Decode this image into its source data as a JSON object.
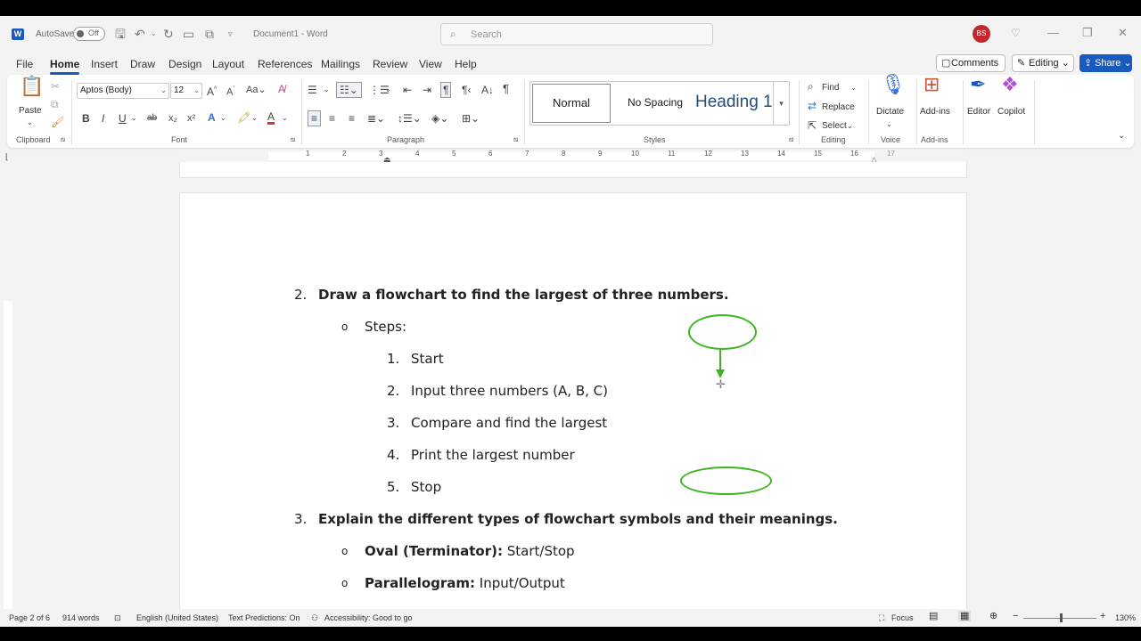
{
  "titlebar": {
    "autosave_label": "AutoSave",
    "autosave_state": "Off",
    "document_title": "Document1  -  Word",
    "search_placeholder": "Search",
    "user_initials": "BS"
  },
  "tabs": [
    "File",
    "Home",
    "Insert",
    "Draw",
    "Design",
    "Layout",
    "References",
    "Mailings",
    "Review",
    "View",
    "Help"
  ],
  "active_tab": "Home",
  "actions": {
    "comments": "Comments",
    "editing": "Editing",
    "share": "Share"
  },
  "ribbon": {
    "clipboard": {
      "paste": "Paste",
      "group": "Clipboard"
    },
    "font": {
      "name": "Aptos (Body)",
      "size": "12",
      "group": "Font",
      "bold": "B",
      "italic": "I",
      "underline": "U",
      "strike": "ab",
      "sub": "x₂",
      "sup": "x²"
    },
    "paragraph": {
      "group": "Paragraph"
    },
    "styles": {
      "normal": "Normal",
      "no_spacing": "No Spacing",
      "heading": "Heading 1",
      "group": "Styles"
    },
    "editing": {
      "find": "Find",
      "replace": "Replace",
      "select": "Select",
      "group": "Editing"
    },
    "voice": {
      "dictate": "Dictate",
      "group": "Voice"
    },
    "addins": {
      "addins": "Add-ins",
      "group": "Add-ins"
    },
    "editor": "Editor",
    "copilot": "Copilot"
  },
  "ruler": {
    "numbers": [
      "1",
      "2",
      "3",
      "4",
      "5",
      "6",
      "7",
      "8",
      "9",
      "10",
      "11",
      "12",
      "13",
      "14",
      "15",
      "16",
      "17"
    ]
  },
  "document": {
    "q2": {
      "num": "2.",
      "text": "Draw a flowchart to find the largest of three numbers."
    },
    "steps_label": "Steps:",
    "steps": [
      {
        "num": "1.",
        "text": "Start"
      },
      {
        "num": "2.",
        "text": "Input three numbers (A, B, C)"
      },
      {
        "num": "3.",
        "text": "Compare and find the largest"
      },
      {
        "num": "4.",
        "text": "Print the largest number"
      },
      {
        "num": "5.",
        "text": "Stop"
      }
    ],
    "q3": {
      "num": "3.",
      "text": "Explain the different types of flowchart symbols and their meanings."
    },
    "symbols": [
      {
        "term": "Oval (Terminator):",
        "desc": " Start/Stop"
      },
      {
        "term": "Parallelogram:",
        "desc": " Input/Output"
      }
    ]
  },
  "statusbar": {
    "page": "Page 2 of 6",
    "words": "914 words",
    "language": "English (United States)",
    "predictions": "Text Predictions: On",
    "accessibility": "Accessibility: Good to go",
    "focus": "Focus",
    "zoom": "130%"
  },
  "colors": {
    "accent": "#185abd",
    "shape_outline": "#3cb521"
  }
}
